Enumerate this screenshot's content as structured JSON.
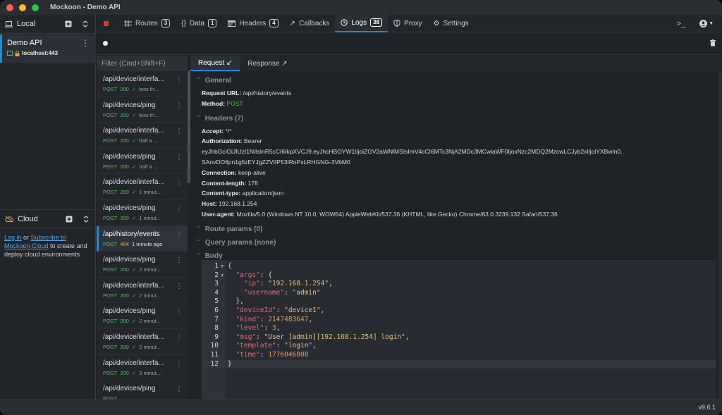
{
  "app": {
    "title": "Mockoon - Demo API",
    "version": "v9.6.1"
  },
  "colors": {
    "accent": "#1e8dd1",
    "post": "#4fbf60",
    "status404": "#e8a33c",
    "stop": "#e5322e"
  },
  "sidebar": {
    "local_label": "Local",
    "env_name": "Demo API",
    "env_host": "localhost:443",
    "cloud_label": "Cloud",
    "cloud_login": "Log in",
    "cloud_or": " or ",
    "cloud_subscribe": "Subscribe to Mockoon Cloud",
    "cloud_rest": " to create and deploy cloud environments"
  },
  "tabs": [
    {
      "label": "Routes",
      "badge": "3",
      "icon": "routes-icon"
    },
    {
      "label": "Data",
      "badge": "1",
      "icon": "data-icon"
    },
    {
      "label": "Headers",
      "badge": "4",
      "icon": "headers-icon"
    },
    {
      "label": "Callbacks",
      "badge": "",
      "icon": "callbacks-icon"
    },
    {
      "label": "Logs",
      "badge": "38",
      "icon": "logs-icon"
    },
    {
      "label": "Proxy",
      "badge": "",
      "icon": "proxy-icon"
    },
    {
      "label": "Settings",
      "badge": "",
      "icon": "gear-icon"
    }
  ],
  "logs": {
    "filter_placeholder": "Filter (Cmd+Shift+F)",
    "items": [
      {
        "path": "/api/device/interfa...",
        "method": "POST",
        "status": "200",
        "when": "less th..."
      },
      {
        "path": "/api/devices/ping",
        "method": "POST",
        "status": "200",
        "when": "less th..."
      },
      {
        "path": "/api/device/interfa...",
        "method": "POST",
        "status": "200",
        "when": "half a ..."
      },
      {
        "path": "/api/devices/ping",
        "method": "POST",
        "status": "200",
        "when": "half a ..."
      },
      {
        "path": "/api/device/interfa...",
        "method": "POST",
        "status": "200",
        "when": "1 minut..."
      },
      {
        "path": "/api/devices/ping",
        "method": "POST",
        "status": "200",
        "when": "1 minut..."
      },
      {
        "path": "/api/history/events",
        "method": "POST",
        "status": "404",
        "when": "1 minute ago"
      },
      {
        "path": "/api/devices/ping",
        "method": "POST",
        "status": "200",
        "when": "2 minut..."
      },
      {
        "path": "/api/device/interfa...",
        "method": "POST",
        "status": "200",
        "when": "2 minut..."
      },
      {
        "path": "/api/devices/ping",
        "method": "POST",
        "status": "200",
        "when": "2 minut..."
      },
      {
        "path": "/api/device/interfa...",
        "method": "POST",
        "status": "200",
        "when": "2 minut..."
      },
      {
        "path": "/api/device/interfa...",
        "method": "POST",
        "status": "200",
        "when": "3 minut..."
      },
      {
        "path": "/api/devices/ping",
        "method": "POST",
        "status": "",
        "when": ""
      }
    ]
  },
  "detail": {
    "request_tab": "Request ↙",
    "response_tab": "Response ↗",
    "general_title": "General",
    "request_url_label": "Request URL:",
    "request_url": "/api/history/events",
    "method_label": "Method:",
    "method": "POST",
    "headers_title": "Headers (7)",
    "headers": [
      {
        "key": "Accept:",
        "value": "*/*"
      },
      {
        "key": "Authorization:",
        "value": "Bearer"
      },
      {
        "key": "",
        "value": "eyJhbGciOiJIUzI1NiIsInR5cCI6IkpXVCJ9.eyJhcHBOYW1lIjoiZGV2aWNlMSIsImV4cCI6MTc3NjA2MDc3MCwiaWF0IjoxNzc2MDQ2MzcwLCJyb2xlIjoiYXBwIn0.SAnvDO6pn1gfizEYJgZZVIIP53IRnPsLRHGNG-3VbM0"
      },
      {
        "key": "Connection:",
        "value": "keep-alive"
      },
      {
        "key": "Content-length:",
        "value": "178"
      },
      {
        "key": "Content-type:",
        "value": "application/json"
      },
      {
        "key": "Host:",
        "value": "192.168.1.254"
      },
      {
        "key": "User-agent:",
        "value": "Mozilla/5.0 (Windows NT 10.0; WOW64) AppleWebKit/537.36 (KHTML, like Gecko) Chrome/63.0.3239.132 Safari/537.36"
      }
    ],
    "route_params_title": "Route params (0)",
    "query_params_title": "Query params (none)",
    "body_title": "Body",
    "body_lines": [
      "{",
      "  \"args\": {",
      "    \"ip\": \"192.168.1.254\",",
      "    \"username\": \"admin\"",
      "  },",
      "  \"deviceId\": \"device1\",",
      "  \"kind\": 2147483647,",
      "  \"level\": 3,",
      "  \"msg\": \"User [admin][192.168.1.254] login\",",
      "  \"template\": \"login\",",
      "  \"time\": 1776046808",
      "}"
    ]
  }
}
